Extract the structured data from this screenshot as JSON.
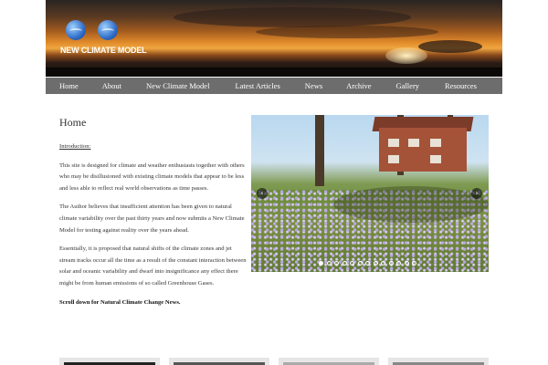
{
  "header": {
    "logo_text": "NEW CLIMATE MODEL"
  },
  "nav": {
    "items": [
      {
        "label": "Home"
      },
      {
        "label": "About"
      },
      {
        "label": "New Climate Model"
      },
      {
        "label": "Latest Articles"
      },
      {
        "label": "News"
      },
      {
        "label": "Archive"
      },
      {
        "label": "Gallery"
      },
      {
        "label": "Resources"
      }
    ]
  },
  "main": {
    "title": "Home",
    "intro_heading": "Introduction:",
    "paragraphs": [
      "This site is designed for climate and weather enthusiasts together with others who may be disillusioned with existing climate models that appear to be less and less able to reflect real world observations as time passes.",
      "The Author believes that insufficient attention has been given to natural climate variability over the past thirty years and now submits a New Climate Model for testing against reality over the years ahead.",
      "Essentially, it is proposed that natural shifts of the climate zones and jet stream tracks occur all the time as a result of the constant interaction between solar and oceanic variability and dwarf into insignificance any effect there might be from human emissions of so called Greenhouse Gases."
    ],
    "scroll_note": "Scroll down for Natural Climate Change News."
  },
  "slider": {
    "slide_count": 13,
    "active_index": 0,
    "prev_icon": "chevron-left-icon",
    "next_icon": "chevron-right-icon"
  },
  "colors": {
    "nav_bg": "#6d6d6d",
    "text": "#333333"
  }
}
